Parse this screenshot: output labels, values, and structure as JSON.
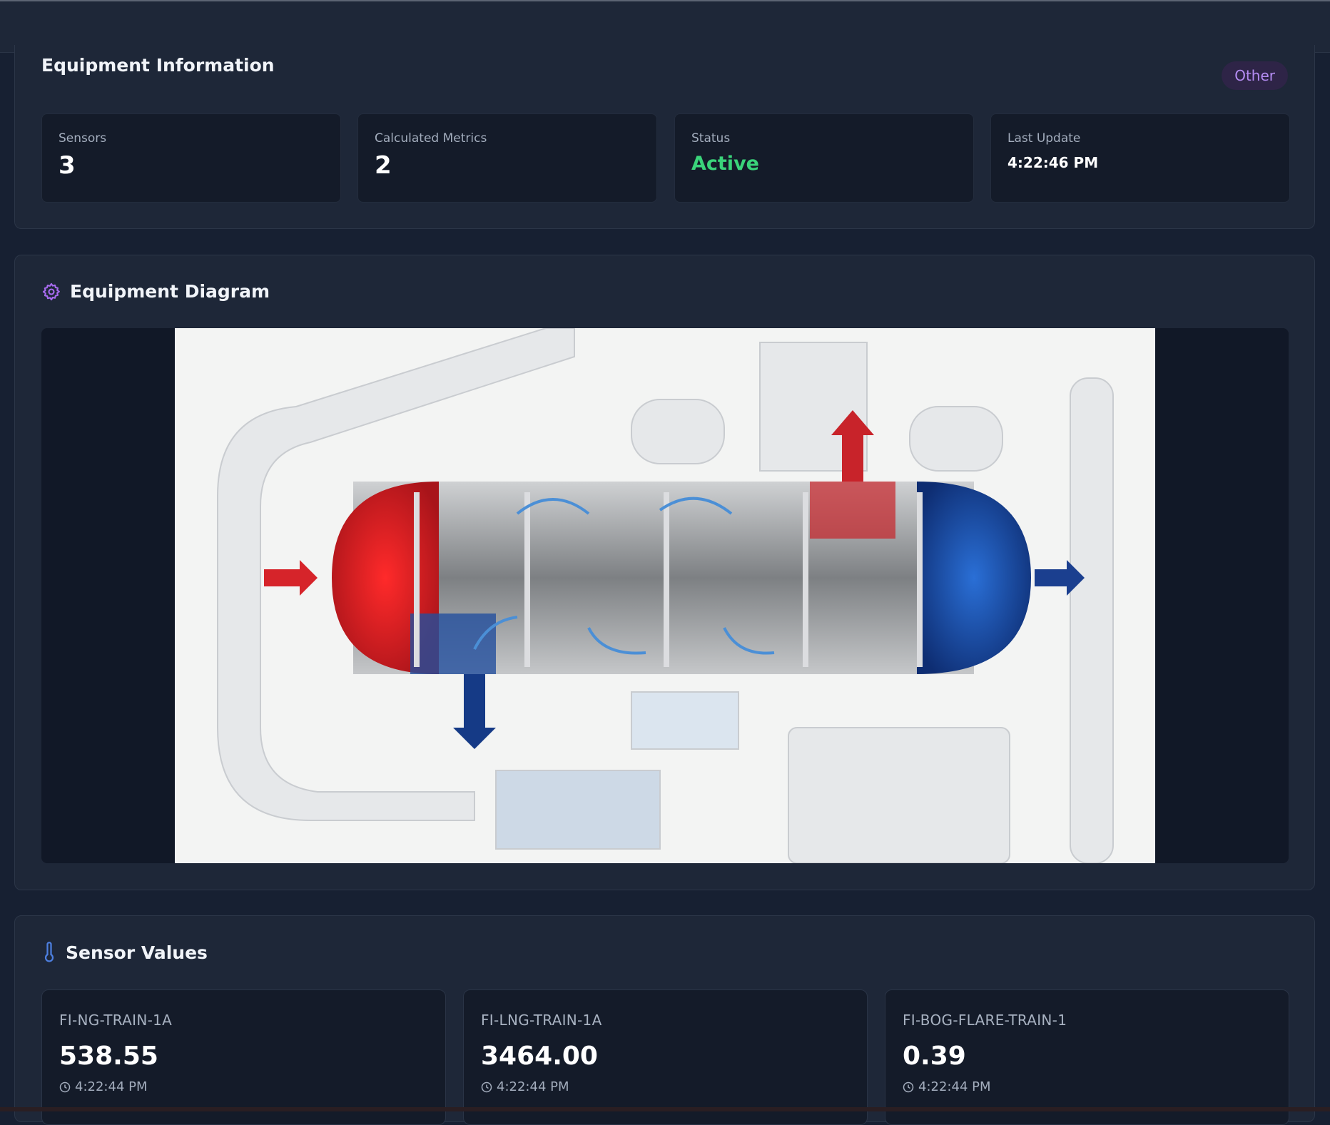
{
  "equipment_info": {
    "title": "Equipment Information",
    "category_badge": "Other",
    "stats": [
      {
        "label": "Sensors",
        "value": "3"
      },
      {
        "label": "Calculated Metrics",
        "value": "2"
      },
      {
        "label": "Status",
        "value": "Active"
      },
      {
        "label": "Last Update",
        "value": "4:22:46 PM"
      }
    ],
    "status_color": "#3ad47a"
  },
  "diagram": {
    "title": "Equipment Diagram",
    "icon": "gear-icon"
  },
  "sensors": {
    "title": "Sensor Values",
    "icon": "thermometer-icon",
    "items": [
      {
        "name": "FI-NG-TRAIN-1A",
        "value": "538.55",
        "time": "4:22:44 PM"
      },
      {
        "name": "FI-LNG-TRAIN-1A",
        "value": "3464.00",
        "time": "4:22:44 PM"
      },
      {
        "name": "FI-BOG-FLARE-TRAIN-1",
        "value": "0.39",
        "time": "4:22:44 PM"
      }
    ]
  },
  "colors": {
    "accent_purple": "#b48cf2",
    "hot": "#d9252a",
    "cold": "#1c4fa3"
  }
}
